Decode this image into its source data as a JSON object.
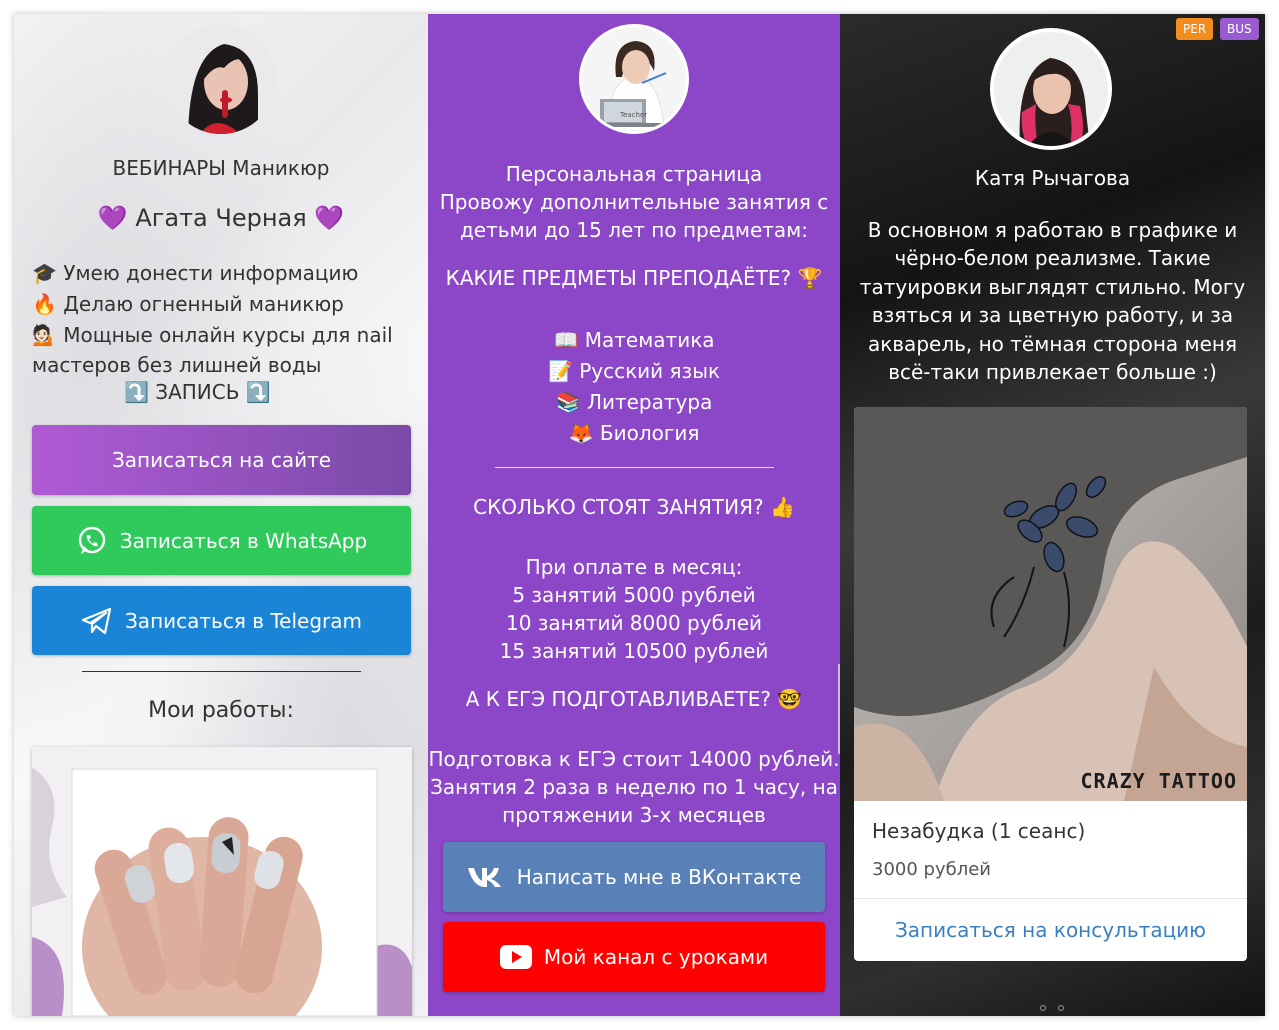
{
  "columns": {
    "manicure": {
      "title": "ВЕБИНАРЫ Маникюр",
      "name": "Агата Черная",
      "heart_emoji": "💜",
      "bullets": [
        {
          "emoji": "🎓",
          "text": "Умею донести информацию"
        },
        {
          "emoji": "🔥",
          "text": "Делаю огненный маникюр"
        },
        {
          "emoji": "💁🏻",
          "text": "Мощные онлайн курсы для nail"
        }
      ],
      "bullet_continuation": "мастеров без лишней воды",
      "record_arrow": "⤵️",
      "record_label": "ЗАПИСЬ",
      "buttons": {
        "site": "Записаться на сайте",
        "whatsapp": "Записаться в WhatsApp",
        "telegram": "Записаться в Telegram"
      },
      "works_heading": "Мои работы:"
    },
    "teacher": {
      "avatar_caption": "Teacher",
      "intro_lines": [
        "Персональная страница",
        "Провожу дополнительные занятия с",
        "детьми до 15 лет по предметам:"
      ],
      "subjects_question": "КАКИЕ ПРЕДМЕТЫ ПРЕПОДАЁТЕ?",
      "subjects_question_emoji": "🏆",
      "subjects": [
        {
          "emoji": "📖",
          "label": "Математика"
        },
        {
          "emoji": "📝",
          "label": "Русский язык"
        },
        {
          "emoji": "📚",
          "label": "Литература"
        },
        {
          "emoji": "🦊",
          "label": "Биология"
        }
      ],
      "price_question": "СКОЛЬКО СТОЯТ ЗАНЯТИЯ?",
      "price_question_emoji": "👍",
      "price_lines": [
        "При оплате в месяц:",
        "5 занятий 5000 рублей",
        "10 занятий 8000 рублей",
        "15 занятий 10500 рублей"
      ],
      "ege_question": "А К ЕГЭ ПОДГОТАВЛИВАЕТЕ?",
      "ege_question_emoji": "🤓",
      "ege_lines": [
        "Подготовка к ЕГЭ стоит 14000 рублей.",
        "Занятия 2 раза в неделю по 1 часу, на",
        "протяжении 3-х месяцев"
      ],
      "buttons": {
        "vk": "Написать мне в ВКонтакте",
        "youtube": "Мой канал с уроками"
      }
    },
    "tattoo": {
      "badges": [
        "PER",
        "BUS"
      ],
      "name": "Катя Рычагова",
      "about_lines": [
        "В основном я работаю в графике и",
        "чёрно-белом реализме. Такие",
        "татуировки выглядят стильно. Могу",
        "взяться и за цветную работу, и за",
        "акварель, но тёмная сторона меня",
        "всё-таки привлекает больше :)"
      ],
      "watermark": "CRAZY TATTOO",
      "product_title": "Незабудка (1 сеанс)",
      "product_price": "3000 рублей",
      "product_button": "Записаться на консультацию"
    }
  },
  "colors": {
    "manicure_site_button": "#8e4fc4",
    "whatsapp": "#2fca5b",
    "telegram": "#1a84d6",
    "teacher_bg": "#8c46c8",
    "vk": "#5981b8",
    "youtube": "#ff0000",
    "badge_per": "#f28c1c",
    "badge_bus": "#9a5bd0",
    "link_blue": "#3a7fc0"
  }
}
